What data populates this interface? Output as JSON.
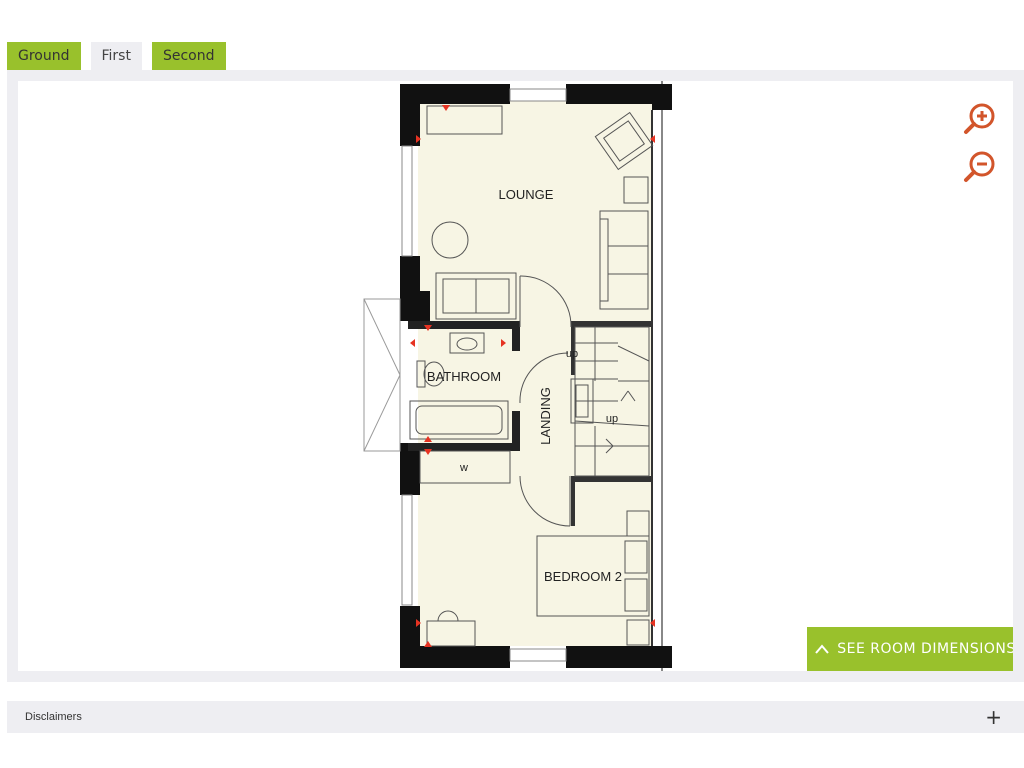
{
  "floor_tabs": [
    {
      "label": "Ground",
      "active": false
    },
    {
      "label": "First",
      "active": true
    },
    {
      "label": "Second",
      "active": false
    }
  ],
  "plan": {
    "rooms": {
      "lounge": "LOUNGE",
      "bathroom": "BATHROOM",
      "landing": "LANDING",
      "bedroom": "BEDROOM 2",
      "wardrobe": "w",
      "stair_up_1": "up",
      "stair_up_2": "up"
    }
  },
  "zoom": {
    "in_icon": "zoom-in-icon",
    "out_icon": "zoom-out-icon"
  },
  "dimensions_button": {
    "label": "SEE ROOM DIMENSIONS",
    "icon": "chevron-up-icon"
  },
  "disclaimer": {
    "label": "Disclaimers",
    "expand_icon": "+"
  },
  "colors": {
    "accent": "#99c12c",
    "panel_bg": "#eeeef2",
    "floor": "#f7f5e4",
    "wall": "#111111",
    "marker": "#e63322",
    "zoom": "#d2552b"
  }
}
